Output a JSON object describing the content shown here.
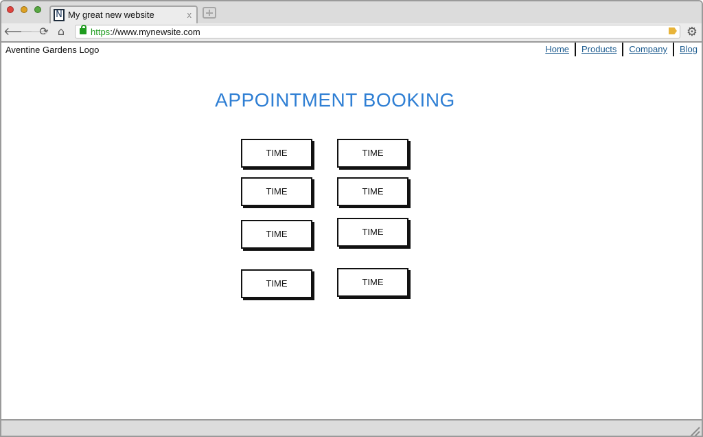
{
  "browser": {
    "tab_title": "My great new website",
    "tab_favicon": "N",
    "tab_close": "x",
    "url_scheme": "https",
    "url_rest": "://www.mynewsite.com",
    "icons": [
      "back-icon",
      "forward-icon",
      "reload-icon",
      "home-icon",
      "lock-icon",
      "bookmark-icon",
      "gear-icon"
    ]
  },
  "header": {
    "logo_text": "Aventine Gardens Logo",
    "nav": [
      "Home",
      "Products",
      "Company",
      "Blog"
    ]
  },
  "main": {
    "heading": "APPOINTMENT BOOKING",
    "time_slots": [
      "TIME",
      "TIME",
      "TIME",
      "TIME",
      "TIME",
      "TIME",
      "TIME",
      "TIME"
    ]
  },
  "colors": {
    "heading": "#2f7fd4",
    "nav_link": "#1b5a8e",
    "secure": "#1f9c1f"
  }
}
